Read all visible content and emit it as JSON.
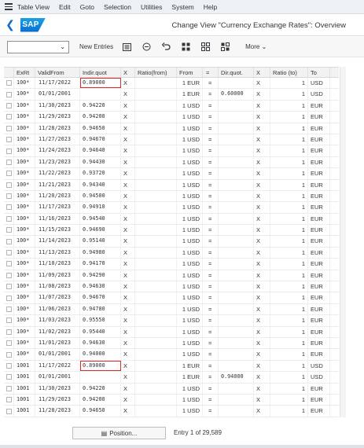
{
  "menu": [
    "Table View",
    "Edit",
    "Goto",
    "Selection",
    "Utilities",
    "System",
    "Help"
  ],
  "shell": {
    "logo": "SAP",
    "title": "Change View \"Currency Exchange Rates\": Overview"
  },
  "toolbar": {
    "new_entries": "New Entries",
    "more": "More"
  },
  "columns": [
    "ExRt",
    "ValidFrom",
    "Indir.quot",
    "X",
    "Ratio(from)",
    "From",
    "=",
    "Dir.quot.",
    "X",
    "Ratio (to)",
    "To"
  ],
  "rows": [
    {
      "exrt": "100*",
      "valid": "11/17/2022",
      "ind": "0.89000",
      "x1": "X",
      "from": "1 EUR",
      "eq": "=",
      "dir": "",
      "x2": "X",
      "rto": "1",
      "to": "USD",
      "hl": true
    },
    {
      "exrt": "100*",
      "valid": "01/01/2001",
      "ind": "",
      "x1": "X",
      "from": "1 EUR",
      "eq": "=",
      "dir": "0.60000",
      "x2": "X",
      "rto": "1",
      "to": "USD"
    },
    {
      "exrt": "100*",
      "valid": "11/30/2023",
      "ind": "0.94220",
      "x1": "X",
      "from": "1 USD",
      "eq": "=",
      "dir": "",
      "x2": "X",
      "rto": "1",
      "to": "EUR"
    },
    {
      "exrt": "100*",
      "valid": "11/29/2023",
      "ind": "0.94200",
      "x1": "X",
      "from": "1 USD",
      "eq": "=",
      "dir": "",
      "x2": "X",
      "rto": "1",
      "to": "EUR"
    },
    {
      "exrt": "100*",
      "valid": "11/28/2023",
      "ind": "0.94650",
      "x1": "X",
      "from": "1 USD",
      "eq": "=",
      "dir": "",
      "x2": "X",
      "rto": "1",
      "to": "EUR"
    },
    {
      "exrt": "100*",
      "valid": "11/27/2023",
      "ind": "0.94670",
      "x1": "X",
      "from": "1 USD",
      "eq": "=",
      "dir": "",
      "x2": "X",
      "rto": "1",
      "to": "EUR"
    },
    {
      "exrt": "100*",
      "valid": "11/24/2023",
      "ind": "0.94640",
      "x1": "X",
      "from": "1 USD",
      "eq": "=",
      "dir": "",
      "x2": "X",
      "rto": "1",
      "to": "EUR"
    },
    {
      "exrt": "100*",
      "valid": "11/23/2023",
      "ind": "0.94430",
      "x1": "X",
      "from": "1 USD",
      "eq": "=",
      "dir": "",
      "x2": "X",
      "rto": "1",
      "to": "EUR"
    },
    {
      "exrt": "100*",
      "valid": "11/22/2023",
      "ind": "0.93720",
      "x1": "X",
      "from": "1 USD",
      "eq": "=",
      "dir": "",
      "x2": "X",
      "rto": "1",
      "to": "EUR"
    },
    {
      "exrt": "100*",
      "valid": "11/21/2023",
      "ind": "0.94340",
      "x1": "X",
      "from": "1 USD",
      "eq": "=",
      "dir": "",
      "x2": "X",
      "rto": "1",
      "to": "EUR"
    },
    {
      "exrt": "100*",
      "valid": "11/20/2023",
      "ind": "0.94500",
      "x1": "X",
      "from": "1 USD",
      "eq": "=",
      "dir": "",
      "x2": "X",
      "rto": "1",
      "to": "EUR"
    },
    {
      "exrt": "100*",
      "valid": "11/17/2023",
      "ind": "0.94910",
      "x1": "X",
      "from": "1 USD",
      "eq": "=",
      "dir": "",
      "x2": "X",
      "rto": "1",
      "to": "EUR"
    },
    {
      "exrt": "100*",
      "valid": "11/16/2023",
      "ind": "0.94540",
      "x1": "X",
      "from": "1 USD",
      "eq": "=",
      "dir": "",
      "x2": "X",
      "rto": "1",
      "to": "EUR"
    },
    {
      "exrt": "100*",
      "valid": "11/15/2023",
      "ind": "0.94690",
      "x1": "X",
      "from": "1 USD",
      "eq": "=",
      "dir": "",
      "x2": "X",
      "rto": "1",
      "to": "EUR"
    },
    {
      "exrt": "100*",
      "valid": "11/14/2023",
      "ind": "0.95140",
      "x1": "X",
      "from": "1 USD",
      "eq": "=",
      "dir": "",
      "x2": "X",
      "rto": "1",
      "to": "EUR"
    },
    {
      "exrt": "100*",
      "valid": "11/13/2023",
      "ind": "0.94980",
      "x1": "X",
      "from": "1 USD",
      "eq": "=",
      "dir": "",
      "x2": "X",
      "rto": "1",
      "to": "EUR"
    },
    {
      "exrt": "100*",
      "valid": "11/10/2023",
      "ind": "0.94170",
      "x1": "X",
      "from": "1 USD",
      "eq": "=",
      "dir": "",
      "x2": "X",
      "rto": "1",
      "to": "EUR"
    },
    {
      "exrt": "100*",
      "valid": "11/09/2023",
      "ind": "0.94290",
      "x1": "X",
      "from": "1 USD",
      "eq": "=",
      "dir": "",
      "x2": "X",
      "rto": "1",
      "to": "EUR"
    },
    {
      "exrt": "100*",
      "valid": "11/08/2023",
      "ind": "0.94630",
      "x1": "X",
      "from": "1 USD",
      "eq": "=",
      "dir": "",
      "x2": "X",
      "rto": "1",
      "to": "EUR"
    },
    {
      "exrt": "100*",
      "valid": "11/07/2023",
      "ind": "0.94670",
      "x1": "X",
      "from": "1 USD",
      "eq": "=",
      "dir": "",
      "x2": "X",
      "rto": "1",
      "to": "EUR"
    },
    {
      "exrt": "100*",
      "valid": "11/06/2023",
      "ind": "0.94780",
      "x1": "X",
      "from": "1 USD",
      "eq": "=",
      "dir": "",
      "x2": "X",
      "rto": "1",
      "to": "EUR"
    },
    {
      "exrt": "100*",
      "valid": "11/03/2023",
      "ind": "0.95550",
      "x1": "X",
      "from": "1 USD",
      "eq": "=",
      "dir": "",
      "x2": "X",
      "rto": "1",
      "to": "EUR"
    },
    {
      "exrt": "100*",
      "valid": "11/02/2023",
      "ind": "0.95440",
      "x1": "X",
      "from": "1 USD",
      "eq": "=",
      "dir": "",
      "x2": "X",
      "rto": "1",
      "to": "EUR"
    },
    {
      "exrt": "100*",
      "valid": "11/01/2023",
      "ind": "0.94630",
      "x1": "X",
      "from": "1 USD",
      "eq": "=",
      "dir": "",
      "x2": "X",
      "rto": "1",
      "to": "EUR"
    },
    {
      "exrt": "100*",
      "valid": "01/01/2001",
      "ind": "0.94000",
      "x1": "X",
      "from": "1 USD",
      "eq": "=",
      "dir": "",
      "x2": "X",
      "rto": "1",
      "to": "EUR"
    },
    {
      "exrt": "1001",
      "valid": "11/17/2022",
      "ind": "0.89000",
      "x1": "X",
      "from": "1 EUR",
      "eq": "=",
      "dir": "",
      "x2": "X",
      "rto": "1",
      "to": "USD",
      "hl": true
    },
    {
      "exrt": "1001",
      "valid": "01/01/2001",
      "ind": "",
      "x1": "X",
      "from": "1 EUR",
      "eq": "=",
      "dir": "0.94000",
      "x2": "X",
      "rto": "1",
      "to": "USD"
    },
    {
      "exrt": "1001",
      "valid": "11/30/2023",
      "ind": "0.94220",
      "x1": "X",
      "from": "1 USD",
      "eq": "=",
      "dir": "",
      "x2": "X",
      "rto": "1",
      "to": "EUR"
    },
    {
      "exrt": "1001",
      "valid": "11/29/2023",
      "ind": "0.94200",
      "x1": "X",
      "from": "1 USD",
      "eq": "=",
      "dir": "",
      "x2": "X",
      "rto": "1",
      "to": "EUR"
    },
    {
      "exrt": "1001",
      "valid": "11/28/2023",
      "ind": "0.94650",
      "x1": "X",
      "from": "1 USD",
      "eq": "=",
      "dir": "",
      "x2": "X",
      "rto": "1",
      "to": "EUR"
    }
  ],
  "footer": {
    "position_button": "Position...",
    "entry_text": "Entry 1 of 29,589"
  },
  "colors": {
    "accent": "#0a6ed1",
    "highlight": "#d92c2c",
    "header_bg": "#f2f2f2"
  },
  "icons": [
    "menu-icon",
    "back-icon",
    "dropdown-chevron-icon",
    "details-icon",
    "delete-icon",
    "undo-icon",
    "select-all-icon",
    "deselect-all-icon",
    "select-block-icon",
    "more-chevron-icon",
    "position-icon"
  ]
}
